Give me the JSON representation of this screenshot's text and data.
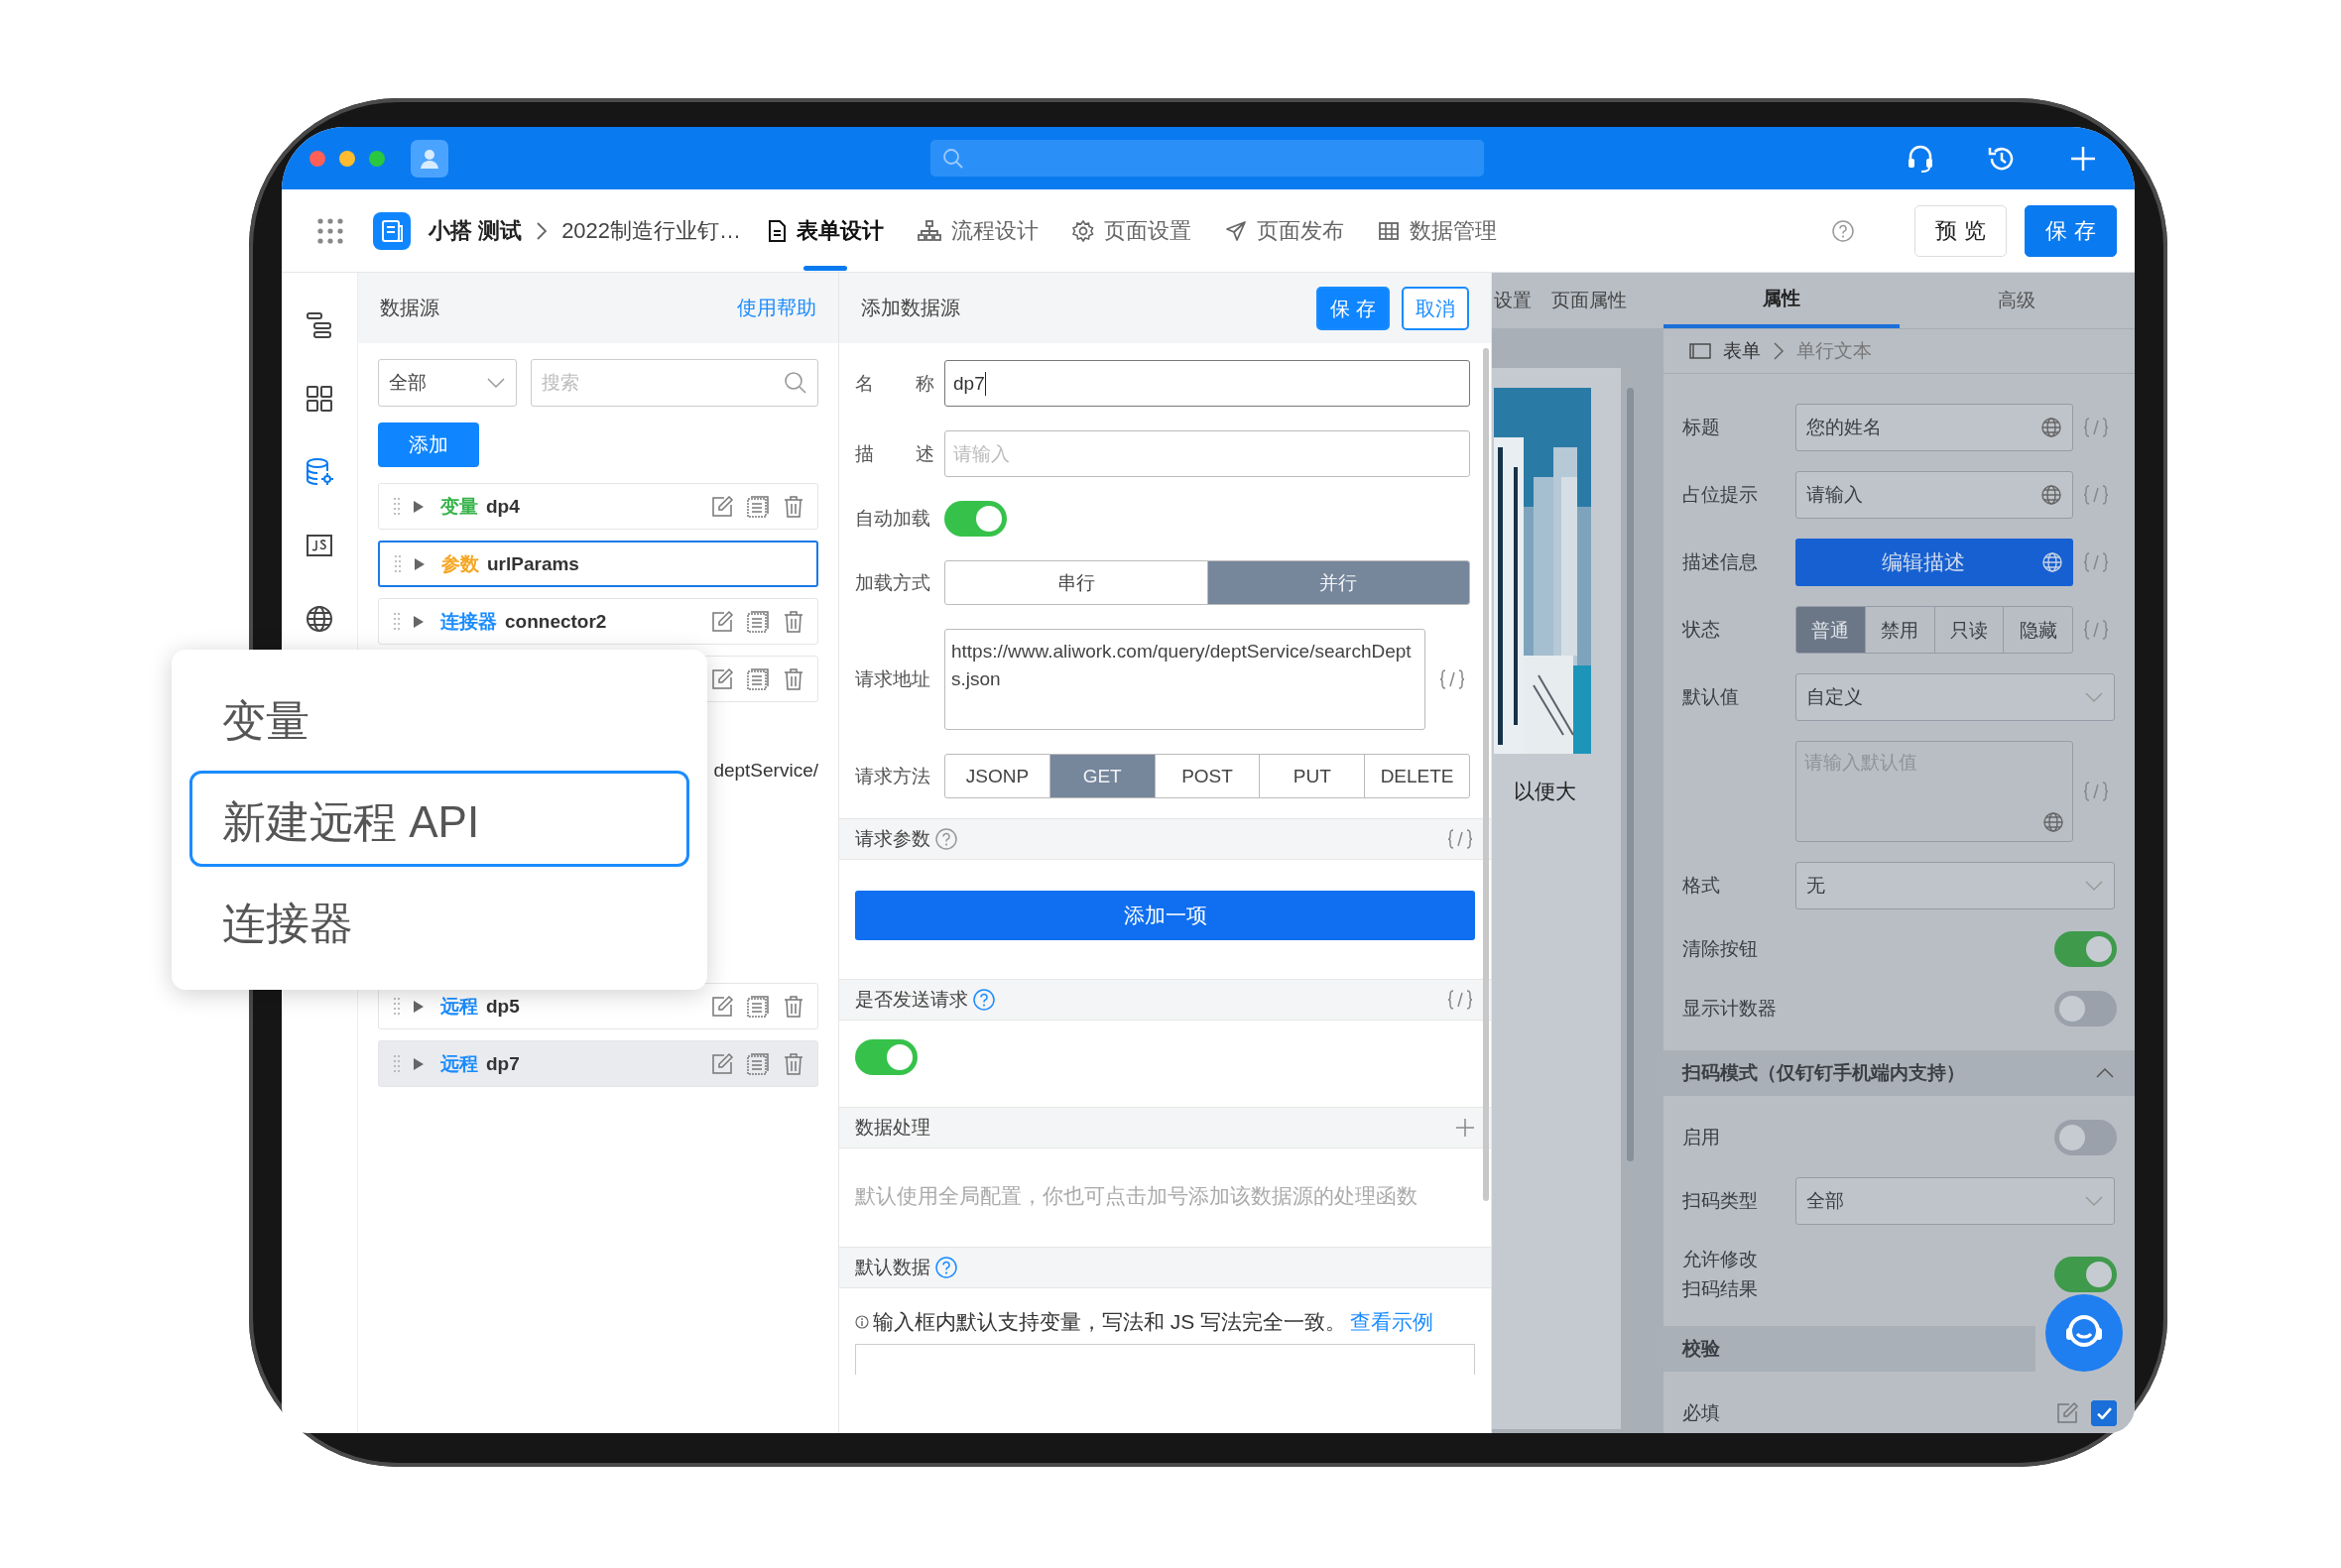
{
  "top_bar": {
    "search": {
      "kind": "search"
    }
  },
  "nav": {
    "app_name": "小搭 测试",
    "form_name": "2022制造行业钉…",
    "tabs": [
      {
        "label": "表单设计",
        "kind": "document",
        "selected": true
      },
      {
        "label": "流程设计",
        "kind": "flow",
        "selected": false
      },
      {
        "label": "页面设置",
        "kind": "gear",
        "selected": false
      },
      {
        "label": "页面发布",
        "kind": "send",
        "selected": false
      },
      {
        "label": "数据管理",
        "kind": "table",
        "selected": false
      }
    ],
    "buttons": [
      {
        "label": "预 览",
        "kind": "default"
      },
      {
        "label": "保 存",
        "kind": "primary"
      }
    ]
  },
  "rail": [
    {
      "kind": "outline",
      "selected": false
    },
    {
      "kind": "components",
      "selected": false
    },
    {
      "kind": "database",
      "selected": true
    },
    {
      "kind": "js",
      "selected": false
    },
    {
      "kind": "globe",
      "selected": false
    }
  ],
  "data_source_panel": {
    "title": "数据源",
    "help_link": "使用帮助",
    "filter": {
      "value": "全部"
    },
    "search": {
      "placeholder": "搜索"
    },
    "add_button": "添加",
    "items": [
      {
        "tag": "变量",
        "color": "#36b34a",
        "name": "dp4",
        "actions": true,
        "focused": false,
        "selected": false
      },
      {
        "tag": "参数",
        "color": "#f5a623",
        "name": "urlParams",
        "actions": false,
        "focused": true,
        "selected": false
      },
      {
        "tag": "连接器",
        "color": "#1a8cff",
        "name": "connector2",
        "actions": true,
        "focused": false,
        "selected": false
      },
      {
        "actions": true,
        "focused": false,
        "selected": false,
        "detail": "deptService/"
      },
      {
        "tag": "远程",
        "color": "#1a8cff",
        "name": "dp5",
        "actions": true,
        "focused": false,
        "selected": false
      },
      {
        "tag": "远程",
        "color": "#1a8cff",
        "name": "dp7",
        "actions": true,
        "focused": false,
        "selected": true
      }
    ]
  },
  "add_menu": {
    "items": [
      {
        "label": "变量",
        "selected": false
      },
      {
        "label": "新建远程 API",
        "selected": true
      },
      {
        "label": "连接器",
        "selected": false
      }
    ]
  },
  "editor": {
    "title": "添加数据源",
    "save_button": "保 存",
    "cancel_button": "取消",
    "name": {
      "label": "名称",
      "value": "dp7"
    },
    "description": {
      "label": "描述",
      "placeholder": "请输入"
    },
    "auto_load": {
      "label": "自动加载",
      "on": true
    },
    "load_mode": {
      "label": "加载方式",
      "options": [
        {
          "label": "串行",
          "selected": false
        },
        {
          "label": "并行",
          "selected": true
        }
      ]
    },
    "url": {
      "label": "请求地址",
      "value": "https://www.aliwork.com/query/deptService/searchDepts.json"
    },
    "method": {
      "label": "请求方法",
      "options": [
        {
          "label": "JSONP",
          "selected": false
        },
        {
          "label": "GET",
          "selected": true
        },
        {
          "label": "POST",
          "selected": false
        },
        {
          "label": "PUT",
          "selected": false
        },
        {
          "label": "DELETE",
          "selected": false
        }
      ]
    },
    "request_params": {
      "title": "请求参数",
      "add_button": "添加一项"
    },
    "send_request": {
      "title": "是否发送请求",
      "on": true
    },
    "data_processing": {
      "title": "数据处理",
      "hint": "默认使用全局配置，你也可点击加号添加该数据源的处理函数"
    },
    "default_data": {
      "title": "默认数据",
      "note": "输入框内默认支持变量，写法和 JS 写法完全一致。",
      "link": "查看示例"
    }
  },
  "canvas": {
    "tabs": [
      "设置",
      "页面属性"
    ],
    "caption": "以便大"
  },
  "properties_panel": {
    "tabs": [
      {
        "label": "属性",
        "selected": true
      },
      {
        "label": "高级",
        "selected": false
      }
    ],
    "breadcrumb": [
      "表单",
      "单行文本"
    ],
    "fields": [
      {
        "kind": "input",
        "label": "标题",
        "value": "您的姓名"
      },
      {
        "kind": "input",
        "label": "占位提示",
        "value": "请输入"
      },
      {
        "kind": "button",
        "label": "描述信息",
        "value": "编辑描述"
      },
      {
        "kind": "segmented",
        "label": "状态",
        "options": [
          {
            "label": "普通",
            "selected": true
          },
          {
            "label": "禁用",
            "selected": false
          },
          {
            "label": "只读",
            "selected": false
          },
          {
            "label": "隐藏",
            "selected": false
          }
        ]
      },
      {
        "kind": "select",
        "label": "默认值",
        "value": "自定义"
      },
      {
        "kind": "textarea",
        "placeholder": "请输入默认值"
      },
      {
        "kind": "select",
        "label": "格式",
        "value": "无"
      },
      {
        "kind": "switch",
        "label": "清除按钮",
        "on": true
      },
      {
        "kind": "switch",
        "label": "显示计数器",
        "on": false
      },
      {
        "kind": "section",
        "label": "扫码模式（仅钉钉手机端内支持）",
        "expanded": true
      },
      {
        "kind": "switch",
        "label": "启用",
        "on": false
      },
      {
        "kind": "select",
        "label": "扫码类型",
        "value": "全部"
      },
      {
        "kind": "switch",
        "label": "允许修改扫码结果",
        "on": true
      },
      {
        "kind": "section",
        "label": "校验"
      },
      {
        "kind": "checkbox",
        "label": "必填",
        "checked": true
      }
    ]
  }
}
